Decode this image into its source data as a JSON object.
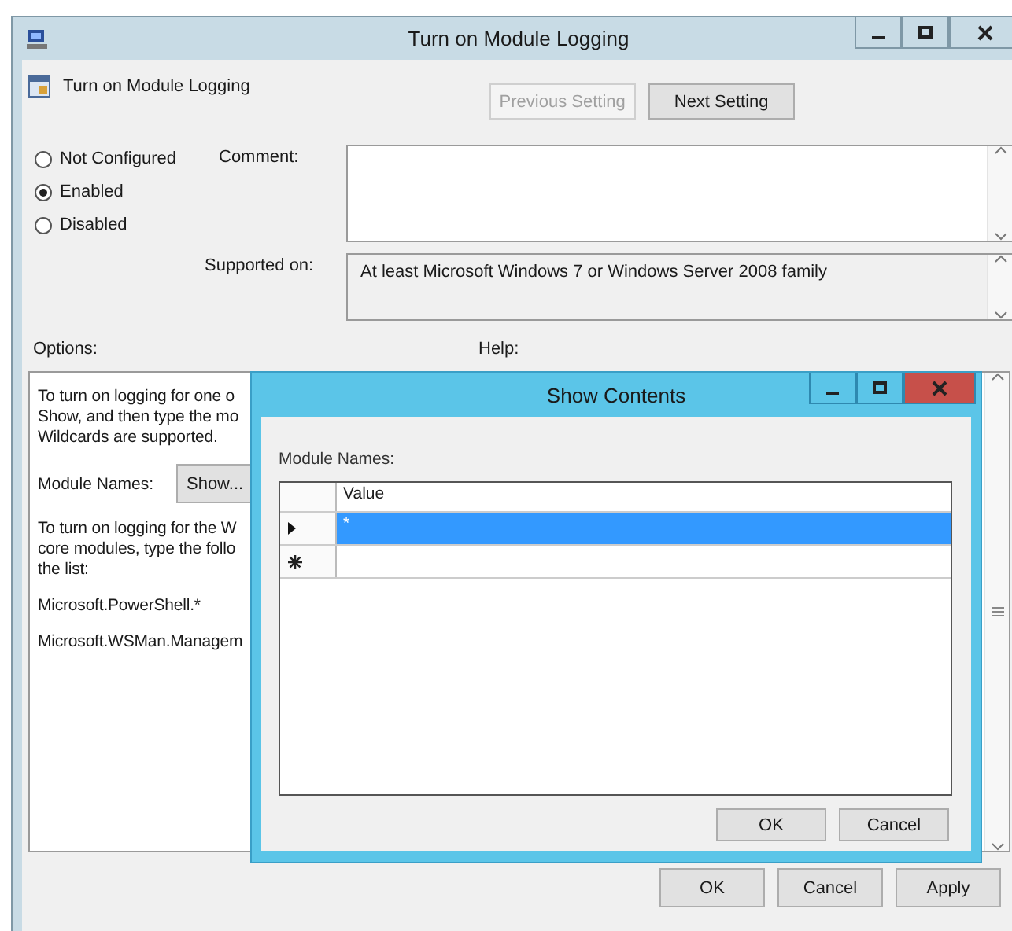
{
  "window": {
    "title": "Turn on Module Logging"
  },
  "setting": {
    "title": "Turn on Module Logging"
  },
  "nav_buttons": [
    {
      "label": "Previous Setting",
      "disabled": true
    },
    {
      "label": "Next Setting",
      "disabled": false
    }
  ],
  "state_options": [
    {
      "label": "Not Configured",
      "selected": false
    },
    {
      "label": "Enabled",
      "selected": true
    },
    {
      "label": "Disabled",
      "selected": false
    }
  ],
  "comment": {
    "label": "Comment:"
  },
  "supported_on": {
    "label": "Supported on:",
    "value": "At least Microsoft Windows 7 or Windows Server 2008 family"
  },
  "options": {
    "label": "Options:",
    "items": [
      {
        "kind": "text",
        "lines": [
          "To turn on logging for one o",
          "Show, and then type the mo",
          "Wildcards are supported."
        ]
      },
      {
        "kind": "button_row",
        "label": "Module Names:",
        "button": "Show..."
      },
      {
        "kind": "text",
        "lines": [
          "To turn on logging for the W",
          "core modules, type the follo",
          "the list:"
        ]
      },
      {
        "kind": "text",
        "lines": [
          "Microsoft.PowerShell.*"
        ]
      },
      {
        "kind": "text",
        "lines": [
          "Microsoft.WSMan.Managem"
        ]
      }
    ]
  },
  "help": {
    "label": "Help:"
  },
  "dialog": {
    "title": "Show Contents",
    "list_label": "Module Names:",
    "columns": [
      "Value"
    ],
    "rows": [
      {
        "kind": "current",
        "value": "*",
        "selected": true
      },
      {
        "kind": "new",
        "selected": false
      }
    ],
    "buttons": [
      "OK",
      "Cancel"
    ]
  },
  "buttons": [
    "OK",
    "Cancel",
    "Apply"
  ]
}
